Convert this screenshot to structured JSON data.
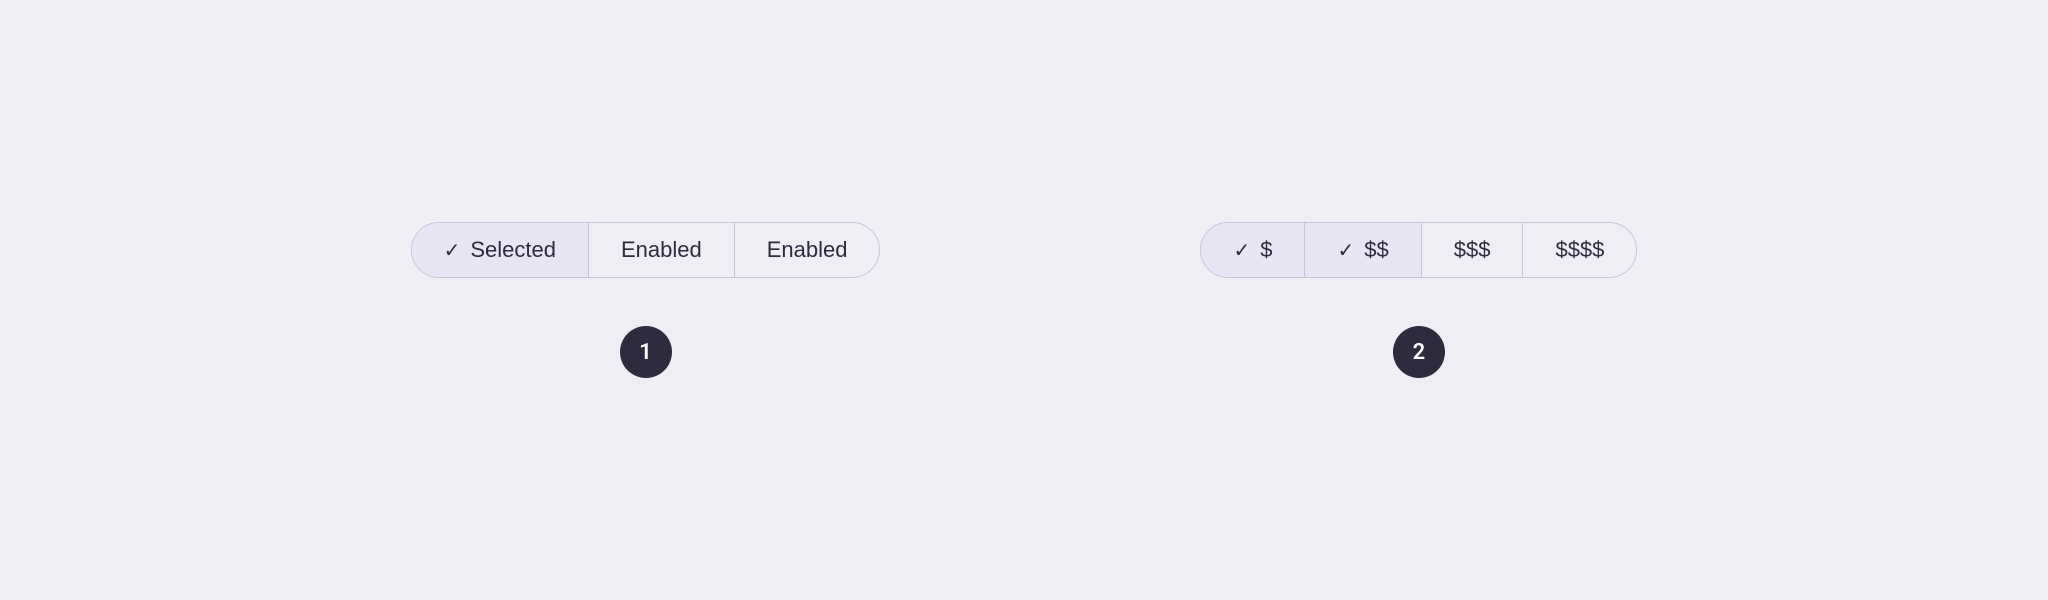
{
  "section1": {
    "segments": [
      {
        "id": "selected",
        "label": "Selected",
        "checked": true,
        "selected": true
      },
      {
        "id": "enabled1",
        "label": "Enabled",
        "checked": false,
        "selected": false
      },
      {
        "id": "enabled2",
        "label": "Enabled",
        "checked": false,
        "selected": false
      }
    ],
    "badge": "1"
  },
  "section2": {
    "segments": [
      {
        "id": "dollar1",
        "label": "$",
        "checked": true,
        "selected": true
      },
      {
        "id": "dollar2",
        "label": "$$",
        "checked": true,
        "selected": true
      },
      {
        "id": "dollar3",
        "label": "$$$",
        "checked": false,
        "selected": false
      },
      {
        "id": "dollar4",
        "label": "$$$$",
        "checked": false,
        "selected": false
      }
    ],
    "badge": "2"
  },
  "icons": {
    "check": "✓"
  }
}
